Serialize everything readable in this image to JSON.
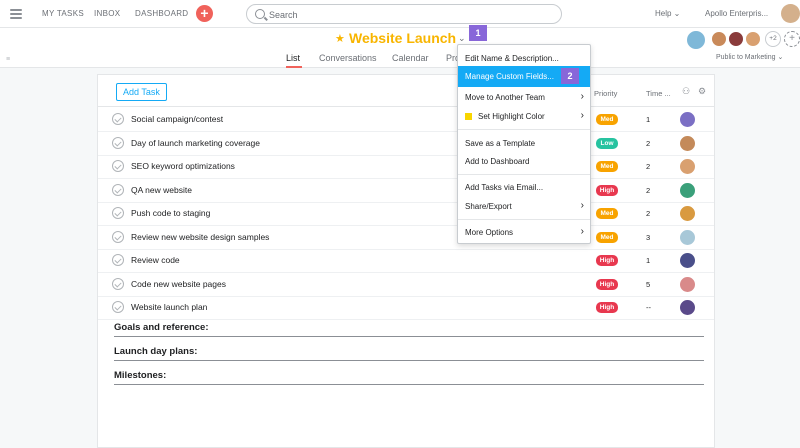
{
  "topbar": {
    "nav": [
      "MY TASKS",
      "INBOX",
      "DASHBOARD"
    ],
    "add_symbol": "+",
    "search_placeholder": "Search",
    "help": "Help ⌄",
    "org": "Apollo Enterpris..."
  },
  "project": {
    "title": "Website Launch",
    "step1": "1",
    "tabs": [
      "List",
      "Conversations",
      "Calendar",
      "Pro"
    ],
    "extra_members": "+2",
    "privacy": "Public to Marketing ⌄"
  },
  "list": {
    "add_task": "Add Task",
    "col_priority": "Priority",
    "col_time": "Time ...",
    "tasks": [
      {
        "name": "Social campaign/contest",
        "priority": "Med",
        "level": "med",
        "time": "1"
      },
      {
        "name": "Day of launch marketing coverage",
        "priority": "Low",
        "level": "low",
        "time": "2"
      },
      {
        "name": "SEO keyword optimizations",
        "priority": "Med",
        "level": "med",
        "time": "2"
      },
      {
        "name": "QA new website",
        "priority": "High",
        "level": "high",
        "time": "2"
      },
      {
        "name": "Push code to staging",
        "priority": "Med",
        "level": "med",
        "time": "2"
      },
      {
        "name": "Review new website design samples",
        "priority": "Med",
        "level": "med",
        "time": "3"
      },
      {
        "name": "Review code",
        "priority": "High",
        "level": "high",
        "time": "1"
      },
      {
        "name": "Code new website pages",
        "priority": "High",
        "level": "high",
        "time": "5"
      },
      {
        "name": "Website launch plan",
        "priority": "High",
        "level": "high",
        "time": "--"
      }
    ],
    "sections": [
      "Goals and reference:",
      "Launch day plans:",
      "Milestones:"
    ]
  },
  "menu": {
    "edit": "Edit Name & Description...",
    "manage": "Manage Custom Fields...",
    "step2": "2",
    "move": "Move to Another Team",
    "highlight": "Set Highlight Color",
    "template": "Save as a Template",
    "dashboard": "Add to Dashboard",
    "email": "Add Tasks via Email...",
    "share": "Share/Export",
    "more": "More Options"
  },
  "colors": {
    "accent": "#14aaf5",
    "title": "#f8b500",
    "step": "#8867d9",
    "med": "#f8a300",
    "low": "#27c3a0",
    "high": "#e8384f"
  }
}
